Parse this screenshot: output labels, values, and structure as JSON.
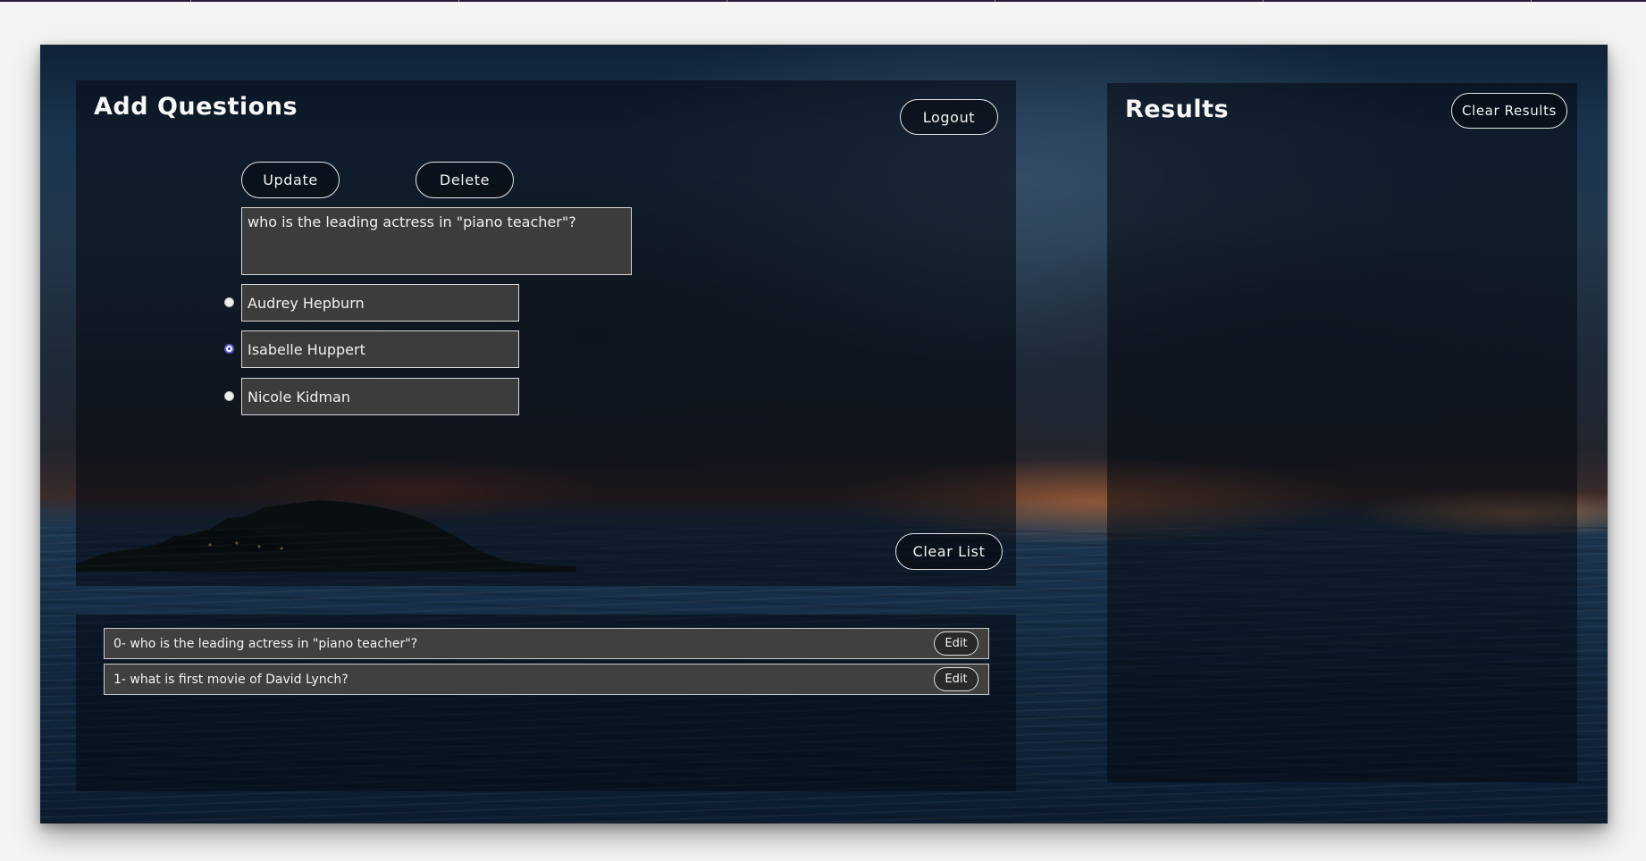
{
  "add_panel": {
    "title": "Add Questions",
    "logout_label": "Logout",
    "update_label": "Update",
    "delete_label": "Delete",
    "question_text": "who is the leading actress in \"piano teacher\"?",
    "answers": [
      {
        "text": "Audrey Hepburn",
        "selected": false
      },
      {
        "text": "Isabelle Huppert",
        "selected": true
      },
      {
        "text": "Nicole Kidman",
        "selected": false
      }
    ],
    "clear_list_label": "Clear List"
  },
  "question_list": {
    "items": [
      {
        "text": "0- who is the leading actress in \"piano teacher\"?",
        "edit_label": "Edit"
      },
      {
        "text": "1- what is first movie of David Lynch?",
        "edit_label": "Edit"
      }
    ]
  },
  "results_panel": {
    "title": "Results",
    "clear_results_label": "Clear Results"
  },
  "colors": {
    "panel_overlay": "#04080e",
    "field_background": "#3c3c3c",
    "radio_selected": "#5b5bd6",
    "page_background": "#f4f4f4"
  }
}
